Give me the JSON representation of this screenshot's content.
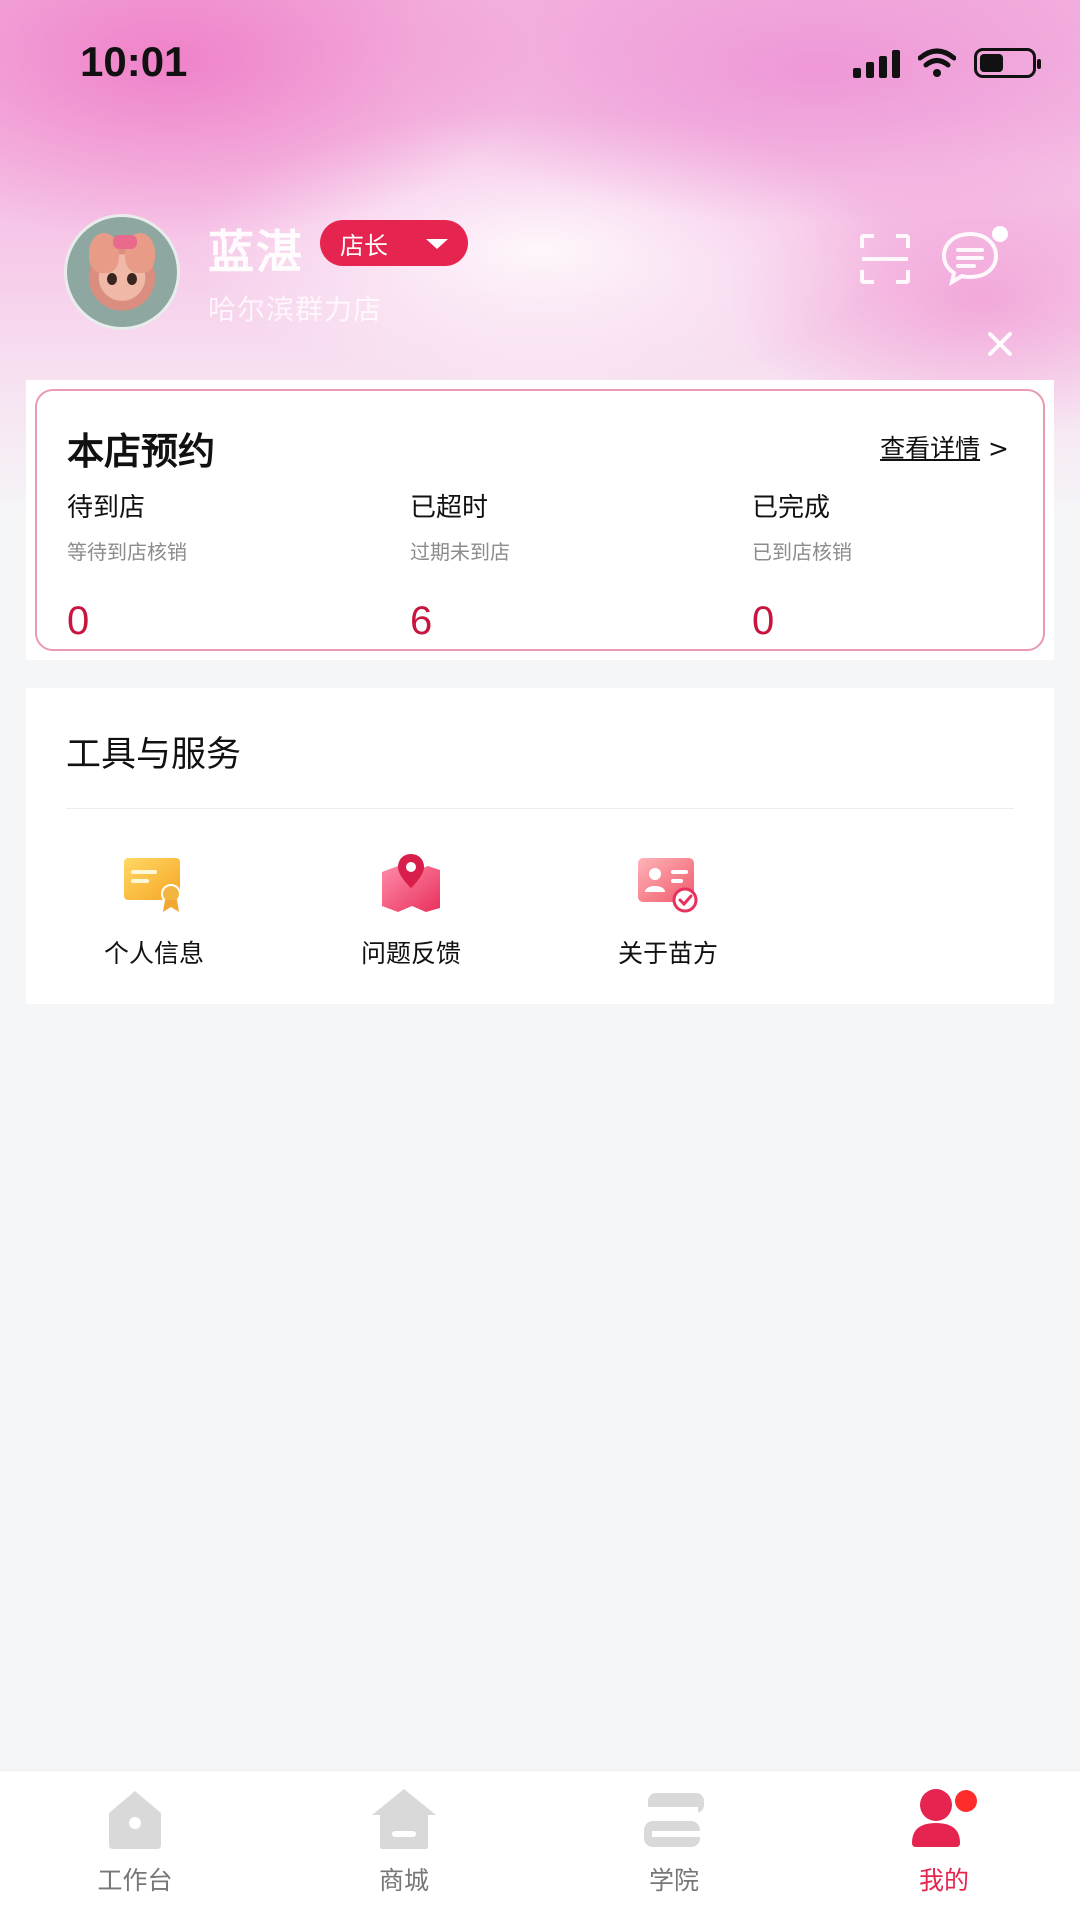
{
  "status_bar": {
    "time": "10:01",
    "battery_level": 0.45
  },
  "profile": {
    "name": "蓝湛",
    "role": "店长",
    "store": "哈尔滨群力店"
  },
  "booking": {
    "title": "本店预约",
    "detail_link": "查看详情",
    "detail_arrow": ">",
    "stats": [
      {
        "label": "待到店",
        "desc": "等待到店核销",
        "value": "0"
      },
      {
        "label": "已超时",
        "desc": "过期未到店",
        "value": "6"
      },
      {
        "label": "已完成",
        "desc": "已到店核销",
        "value": "0"
      }
    ]
  },
  "tools": {
    "title": "工具与服务",
    "items": [
      {
        "label": "个人信息",
        "icon": "certificate-icon"
      },
      {
        "label": "问题反馈",
        "icon": "map-pin-icon"
      },
      {
        "label": "关于苗方",
        "icon": "id-card-check-icon"
      }
    ]
  },
  "tabbar": {
    "items": [
      {
        "label": "工作台",
        "icon": "home-icon"
      },
      {
        "label": "商城",
        "icon": "store-icon"
      },
      {
        "label": "学院",
        "icon": "book-icon"
      },
      {
        "label": "我的",
        "icon": "user-icon",
        "active": true
      }
    ]
  },
  "colors": {
    "accent": "#e5254f",
    "value_red": "#c8153f",
    "inactive_icon": "#d9d9d9"
  }
}
